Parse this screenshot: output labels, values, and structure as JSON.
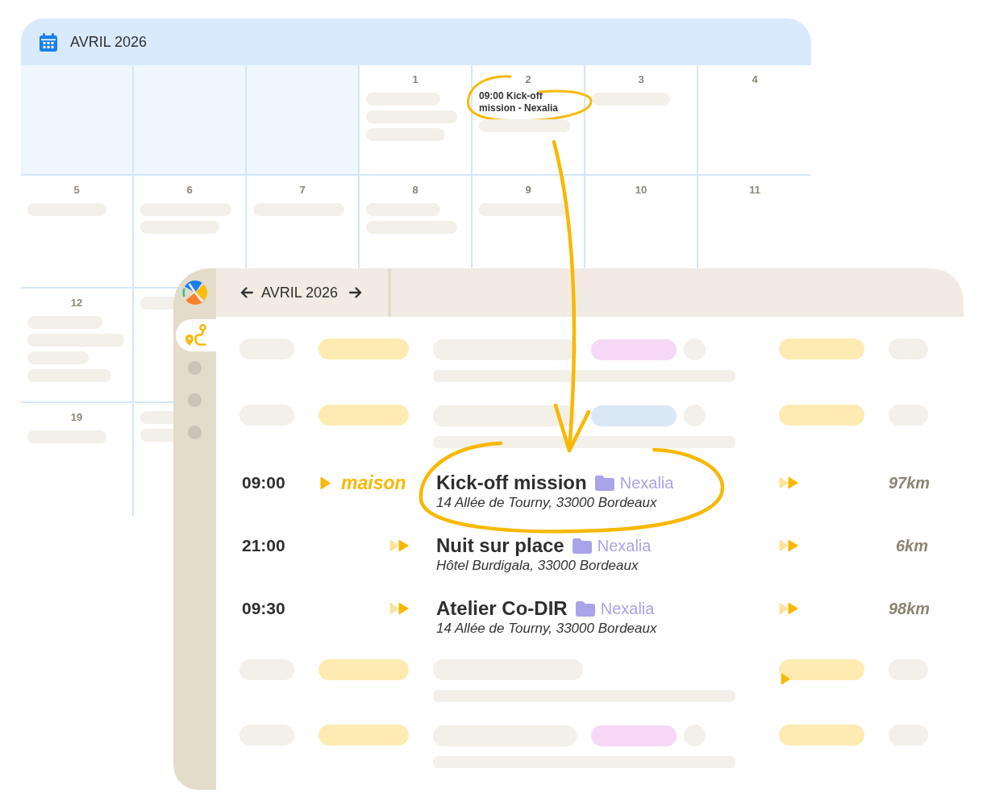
{
  "calendar": {
    "title": "AVRIL 2026",
    "weeks": [
      {
        "days": [
          {
            "outside_month": true
          },
          {
            "outside_month": true
          },
          {
            "outside_month": true
          },
          {
            "outside_month": false,
            "day": "1",
            "events": [
              {
                "kind": "placeholder",
                "circled": false
              },
              {
                "kind": "placeholder",
                "circled": false
              },
              {
                "kind": "placeholder",
                "circled": false
              }
            ]
          },
          {
            "outside_month": false,
            "day": "2",
            "events": [
              {
                "kind": "event",
                "text": "09:00 Kick-off mission - Nexalia",
                "circled": true
              },
              {
                "kind": "placeholder",
                "circled": false
              }
            ]
          },
          {
            "outside_month": false,
            "day": "3",
            "events": [
              {
                "kind": "placeholder",
                "circled": false
              }
            ]
          },
          {
            "outside_month": false,
            "day": "4"
          }
        ]
      },
      {
        "days": [
          {
            "outside_month": false,
            "day": "5",
            "events": [
              {
                "kind": "placeholder",
                "circled": false
              }
            ]
          },
          {
            "outside_month": false,
            "day": "6",
            "events": [
              {
                "kind": "placeholder",
                "circled": false
              },
              {
                "kind": "placeholder",
                "circled": false
              }
            ]
          },
          {
            "outside_month": false,
            "day": "7",
            "events": [
              {
                "kind": "placeholder",
                "circled": false
              }
            ]
          },
          {
            "outside_month": false,
            "day": "8",
            "events": [
              {
                "kind": "placeholder",
                "circled": false
              },
              {
                "kind": "placeholder",
                "circled": false
              }
            ]
          },
          {
            "outside_month": false,
            "day": "9",
            "events": [
              {
                "kind": "placeholder",
                "circled": false
              }
            ]
          },
          {
            "outside_month": false,
            "day": "10"
          },
          {
            "outside_month": false,
            "day": "11"
          }
        ]
      },
      {
        "days": [
          {
            "outside_month": false,
            "day": "12",
            "events": [
              {
                "kind": "placeholder",
                "circled": false
              },
              {
                "kind": "placeholder",
                "circled": false
              },
              {
                "kind": "placeholder",
                "circled": false
              },
              {
                "kind": "placeholder",
                "circled": false
              }
            ]
          },
          {
            "outside_month": false,
            "events": [
              {
                "kind": "placeholder",
                "circled": false
              }
            ]
          }
        ]
      },
      {
        "days": [
          {
            "outside_month": false,
            "day": "19",
            "events": [
              {
                "kind": "placeholder",
                "circled": false
              }
            ]
          },
          {
            "outside_month": false,
            "events": [
              {
                "kind": "placeholder",
                "circled": false
              },
              {
                "kind": "placeholder",
                "circled": false
              }
            ]
          }
        ]
      }
    ]
  },
  "callout_arrow": true,
  "planner": {
    "title": "AVRIL 2026",
    "sidebar": [
      {
        "kind": "route",
        "selected": true
      },
      {
        "kind": "placeholder",
        "selected": false
      },
      {
        "kind": "placeholder",
        "selected": false
      },
      {
        "kind": "placeholder",
        "selected": false
      }
    ],
    "rows": [
      {
        "kind": "placeholder",
        "color": "#f6d7f5",
        "circled": false,
        "now_marker": false
      },
      {
        "kind": "placeholder",
        "color": "#dae7f4",
        "circled": false,
        "now_marker": false
      },
      {
        "kind": "trip",
        "time": "09:00",
        "departure": {
          "kind": "start",
          "label": "maison"
        },
        "title": "Kick-off mission",
        "project": "Nexalia",
        "address": "14 Allée de Tourny, 33000 Bordeaux",
        "distance": "97km",
        "circled": true,
        "now_marker": false
      },
      {
        "kind": "trip",
        "time": "21:00",
        "departure": {
          "kind": "continue"
        },
        "title": "Nuit sur place",
        "project": "Nexalia",
        "address": "Hôtel Burdigala, 33000 Bordeaux",
        "distance": "6km",
        "circled": false,
        "now_marker": false
      },
      {
        "kind": "trip",
        "time": "09:30",
        "departure": {
          "kind": "continue"
        },
        "title": "Atelier Co-DIR",
        "project": "Nexalia",
        "address": "14 Allée de Tourny, 33000 Bordeaux",
        "distance": "98km",
        "circled": false,
        "now_marker": false
      },
      {
        "kind": "placeholder",
        "circled": false,
        "now_marker": true
      },
      {
        "kind": "placeholder",
        "color": "#f6d7f5",
        "circled": false,
        "now_marker": false
      }
    ]
  }
}
